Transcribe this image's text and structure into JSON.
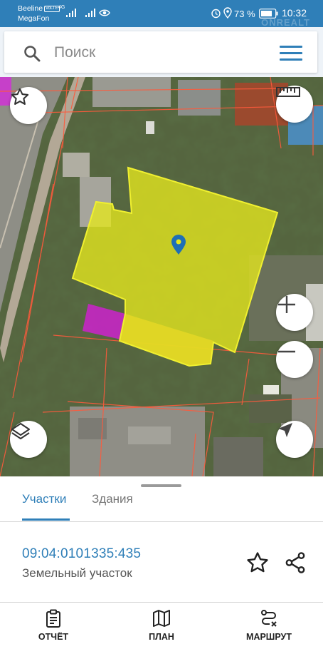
{
  "status_bar": {
    "carrier_1": "Beeline",
    "carrier_1_tag": "VoLTE",
    "network_type": "4G",
    "carrier_2": "MegaFon",
    "battery": "73 %",
    "time": "10:32",
    "icons": [
      "signal-icon",
      "signal-icon",
      "eye-icon",
      "alarm-icon",
      "location-icon",
      "battery-icon"
    ]
  },
  "watermark": "ONREALT",
  "search": {
    "placeholder": "Поиск",
    "icon": "search-icon",
    "menu_icon": "menu-icon"
  },
  "map": {
    "parcel_highlight_color": "#e6e81e",
    "neighbor_highlight_color": "#cc22cc",
    "boundary_color": "#ff5a3c",
    "marker_color": "#1e6fb5",
    "controls": [
      "star-icon",
      "ruler-icon",
      "zoom-in-icon",
      "zoom-out-icon",
      "layers-icon",
      "navigate-icon"
    ]
  },
  "sheet": {
    "tabs": [
      {
        "label": "Участки",
        "active": true
      },
      {
        "label": "Здания",
        "active": false
      }
    ],
    "parcel_id": "09:04:0101335:435",
    "parcel_type": "Земельный участок",
    "accent": "#2f7fb8"
  },
  "bottom_nav": [
    {
      "label": "ОТЧЁТ",
      "icon": "clipboard-icon"
    },
    {
      "label": "ПЛАН",
      "icon": "map-icon"
    },
    {
      "label": "МАРШРУТ",
      "icon": "route-icon"
    }
  ]
}
